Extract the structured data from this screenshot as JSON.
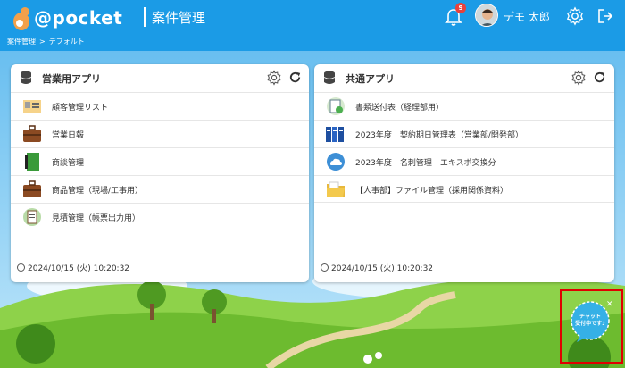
{
  "header": {
    "logo_text": "@pocket",
    "app_title": "案件管理",
    "notification_count": "9",
    "user_name": "デモ 太郎"
  },
  "breadcrumb": [
    "案件管理",
    ">",
    "デフォルト"
  ],
  "panels": [
    {
      "title": "営業用アプリ",
      "items": [
        {
          "label": "顧客管理リスト",
          "icon": "address-card-icon"
        },
        {
          "label": "営業日報",
          "icon": "briefcase-icon"
        },
        {
          "label": "商談管理",
          "icon": "notebook-icon"
        },
        {
          "label": "商品管理（現場/工事用）",
          "icon": "briefcase-icon"
        },
        {
          "label": "見積管理（帳票出力用）",
          "icon": "clipboard-icon"
        }
      ],
      "timestamp": "2024/10/15 (火) 10:20:32"
    },
    {
      "title": "共通アプリ",
      "items": [
        {
          "label": "書類送付表（経理部用）",
          "icon": "document-stamp-icon"
        },
        {
          "label": "2023年度　契約期日管理表（営業部/開発部）",
          "icon": "binders-icon"
        },
        {
          "label": "2023年度　名刺管理　エキスポ交換分",
          "icon": "cloud-icon"
        },
        {
          "label": "【人事部】ファイル管理（採用関係資料）",
          "icon": "folder-icon"
        }
      ],
      "timestamp": "2024/10/15 (火) 10:20:32"
    }
  ],
  "chat": {
    "line1": "チャット",
    "line2": "受付中です♪"
  },
  "colors": {
    "header": "#1b9be6",
    "badge": "#e8413c",
    "chat_outline": "#e00000",
    "chat_bubble": "#35b0e6"
  }
}
